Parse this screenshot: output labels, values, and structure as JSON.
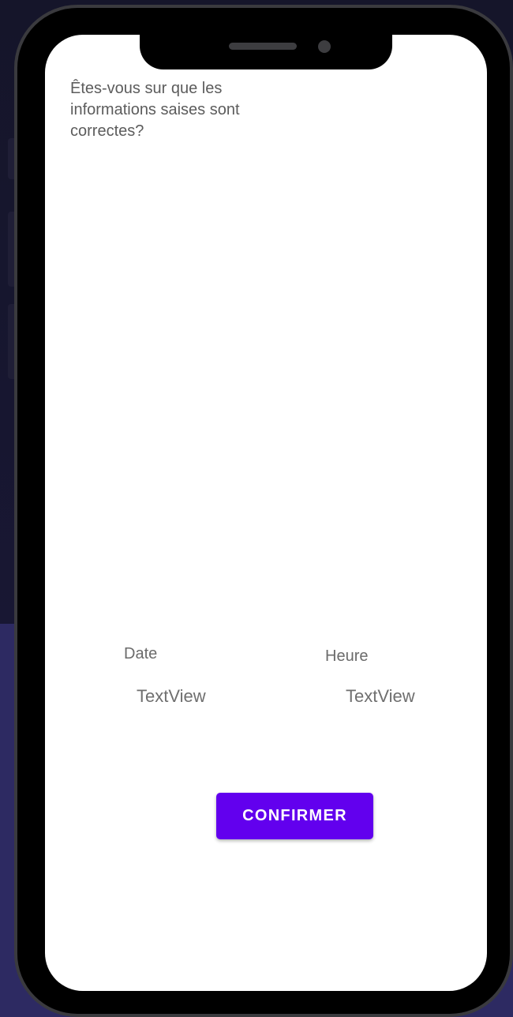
{
  "dialog": {
    "question": "Êtes-vous sur que les informations saises sont correctes?"
  },
  "fields": {
    "date_label": "Date",
    "date_value": "TextView",
    "time_label": "Heure",
    "time_value": "TextView"
  },
  "actions": {
    "confirm_label": "CONFIRMER"
  },
  "colors": {
    "accent": "#6200ee",
    "screen_background": "#ffffff",
    "text": "#5c5c5c"
  }
}
